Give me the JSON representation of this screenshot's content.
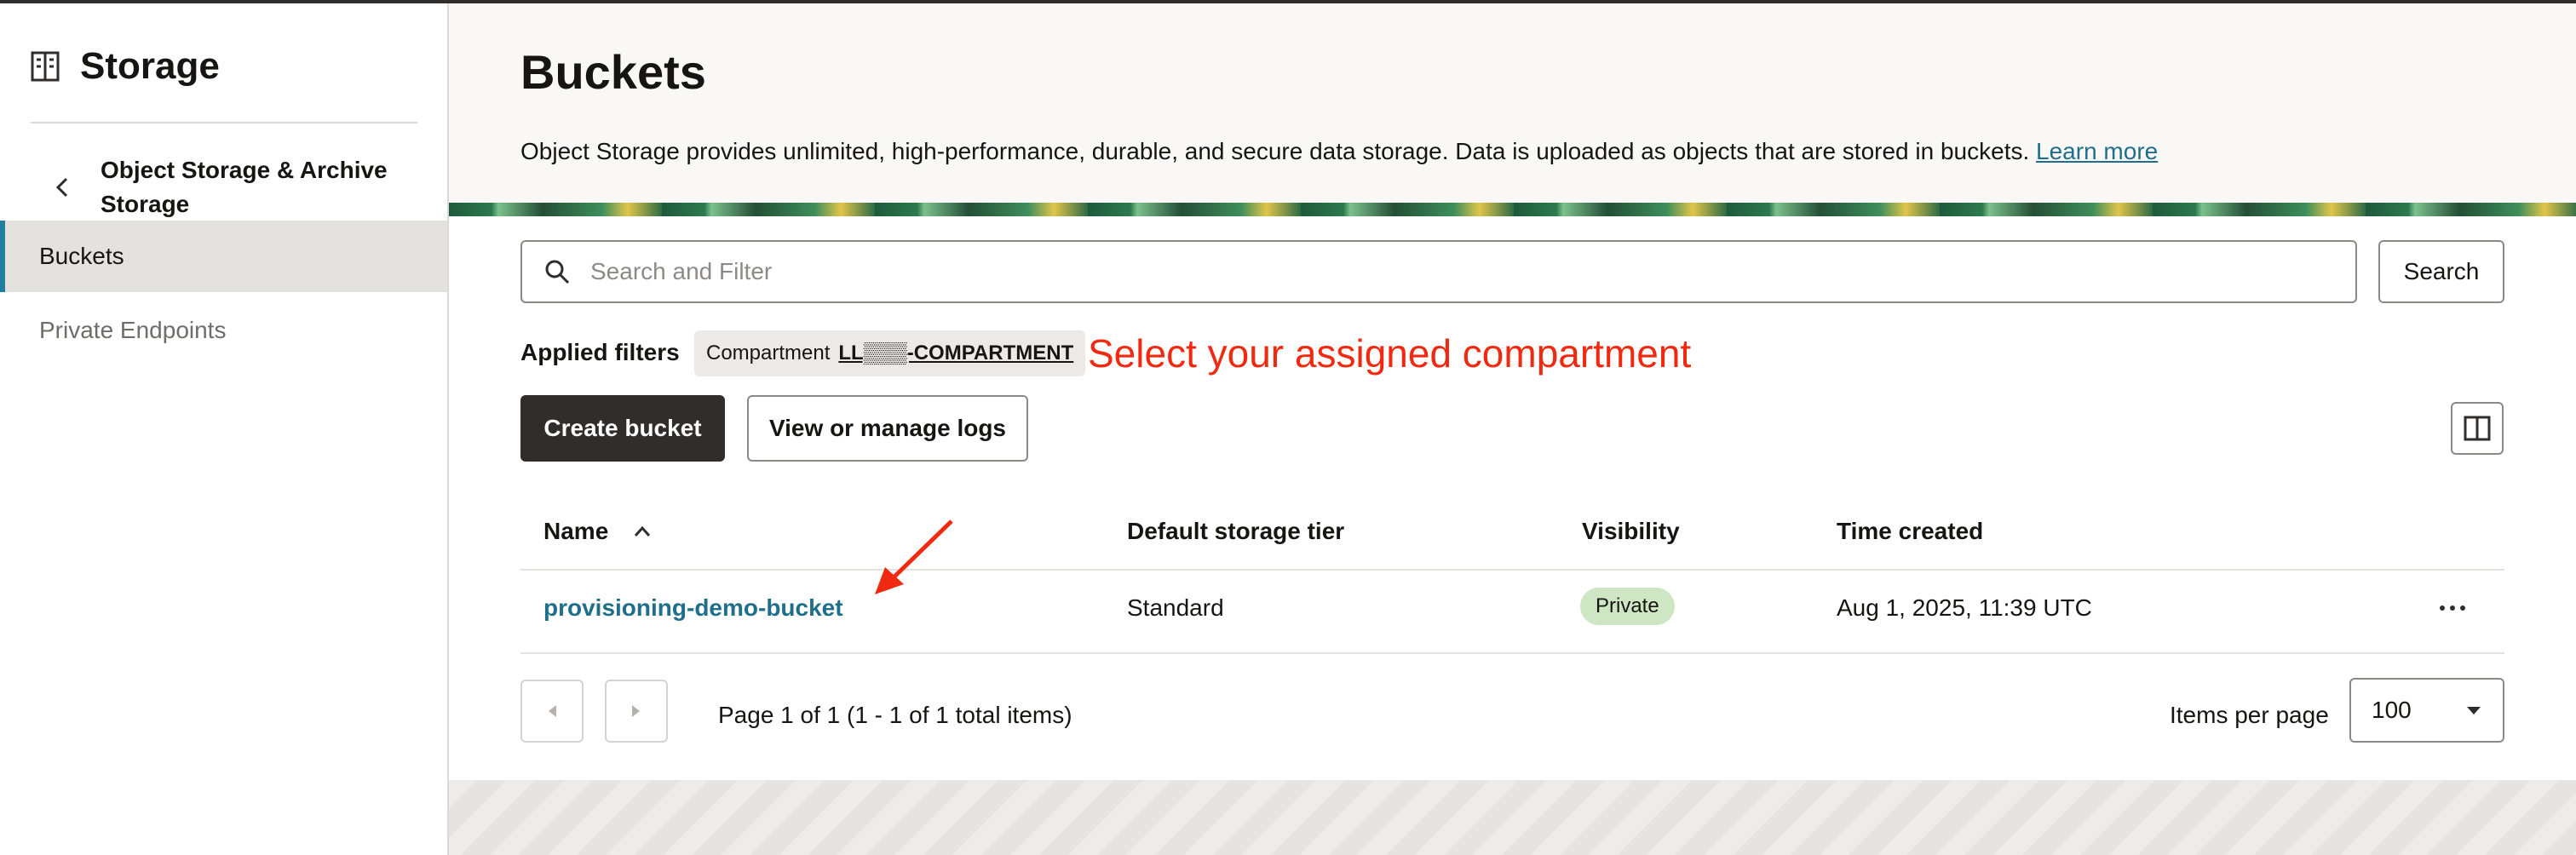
{
  "sidebar": {
    "title": "Storage",
    "header_icon": "storage-grid-icon",
    "back_icon": "chevron-left-icon",
    "section_title": "Object Storage & Archive Storage",
    "items": [
      {
        "label": "Buckets",
        "active": true
      },
      {
        "label": "Private Endpoints",
        "active": false
      }
    ]
  },
  "header": {
    "title": "Buckets",
    "description": "Object Storage provides unlimited, high-performance, durable, and secure data storage. Data is uploaded as objects that are stored in buckets.",
    "learn_more": "Learn more"
  },
  "search": {
    "placeholder": "Search and Filter",
    "value": "",
    "button_label": "Search",
    "icon": "search-icon"
  },
  "filters": {
    "label": "Applied filters",
    "chips": [
      {
        "name": "Compartment",
        "value": "LL▒▒▒-COMPARTMENT"
      }
    ]
  },
  "annotation": {
    "text": "Select your assigned compartment",
    "color": "#ef2a10"
  },
  "actions": {
    "create_label": "Create bucket",
    "logs_label": "View or manage logs",
    "column_toggle_icon": "columns-icon"
  },
  "table": {
    "columns": [
      "Name",
      "Default storage tier",
      "Visibility",
      "Time created"
    ],
    "sort_icon": "chevron-up-icon",
    "rows": [
      {
        "name": "provisioning-demo-bucket",
        "tier": "Standard",
        "visibility": "Private",
        "created": "Aug 1, 2025, 11:39 UTC"
      }
    ],
    "row_actions_icon": "more-horizontal-icon"
  },
  "pagination": {
    "info": "Page 1 of 1 (1 - 1 of 1 total items)",
    "items_per_page_label": "Items per page",
    "items_per_page": "100",
    "prev_icon": "caret-left-icon",
    "next_icon": "caret-right-icon"
  },
  "colors": {
    "accent": "#227e9e",
    "link": "#1f6f8b",
    "primary_button": "#312d2a",
    "badge_private": "#cfe6c4"
  }
}
